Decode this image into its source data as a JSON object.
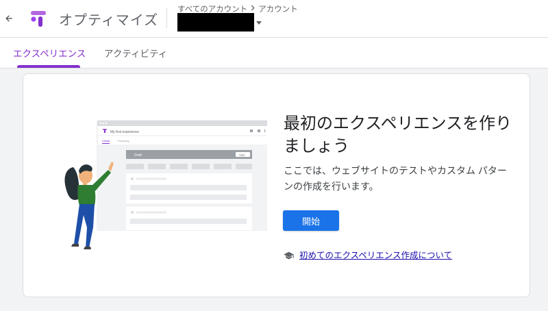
{
  "header": {
    "back_icon": "arrow-back-icon",
    "logo_icon": "optimize-logo-icon",
    "app_title": "オプティマイズ",
    "breadcrumb": {
      "all_accounts": "すべてのアカウント",
      "separator_icon": "chevron-right-icon",
      "account": "アカウント"
    },
    "account_selector": {
      "value": "",
      "redacted": true,
      "dropdown_icon": "caret-down-icon"
    }
  },
  "tabs": [
    {
      "label": "エクスペリエンス",
      "active": true
    },
    {
      "label": "アクティビティ",
      "active": false
    }
  ],
  "empty_state": {
    "illustration": {
      "window_title": "My first experience",
      "tab_labels": [
        "Details",
        "Reporting"
      ],
      "status_label": "Draft",
      "button_label": "Start"
    },
    "headline": "最初のエクスペリエンスを作りましょう",
    "description": "ここでは、ウェブサイトのテストやカスタム パターンの作成を行います。",
    "start_button": "開始",
    "learn_more_icon": "school-cap-icon",
    "learn_more_link": "初めてのエクスペリエンス作成について"
  },
  "colors": {
    "accent": "#8430ce",
    "primary_button": "#1a73e8",
    "link": "#1a0dab",
    "background": "#f1f3f4"
  }
}
